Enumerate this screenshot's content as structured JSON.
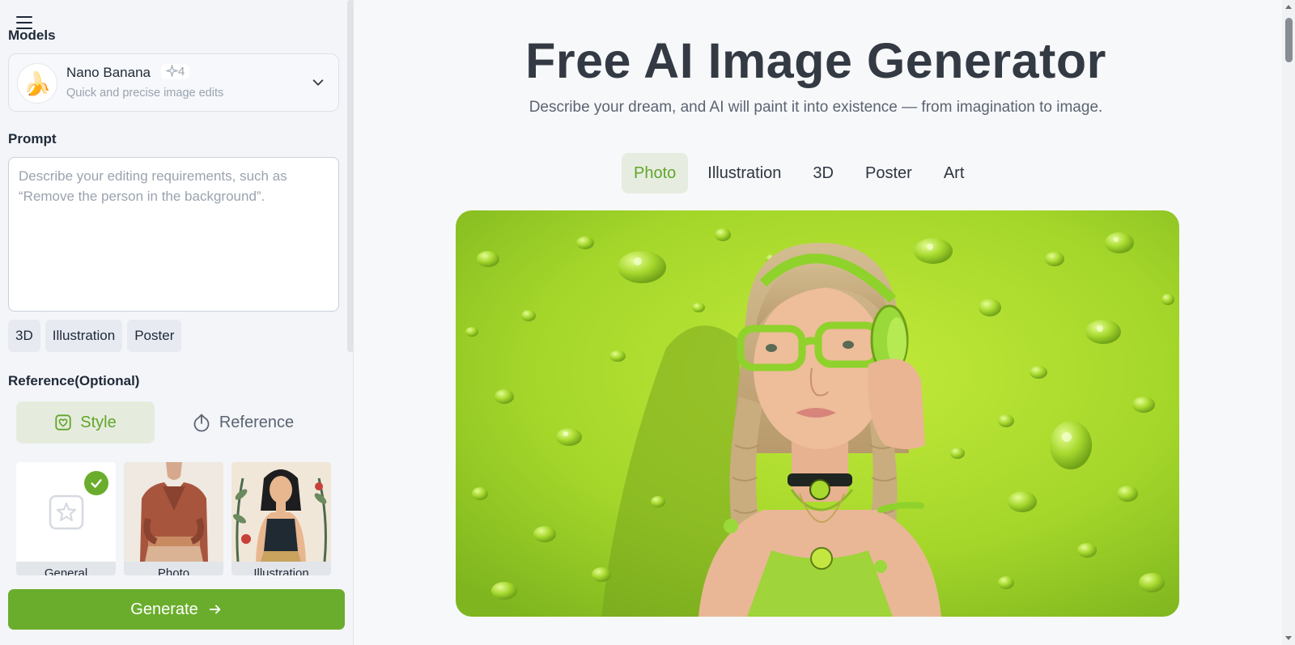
{
  "sidebar": {
    "models_title": "Models",
    "model": {
      "emoji": "🍌",
      "name": "Nano Banana",
      "credits": "4",
      "description": "Quick and precise image edits"
    },
    "prompt_title": "Prompt",
    "prompt": {
      "value": "",
      "placeholder": "Describe your editing requirements, such as “Remove the person in the background”."
    },
    "prompt_tags": [
      "3D",
      "Illustration",
      "Poster"
    ],
    "reference_title": "Reference(Optional)",
    "reference_tabs": {
      "style": "Style",
      "reference": "Reference"
    },
    "styles": [
      {
        "label": "General",
        "selected": true
      },
      {
        "label": "Photo",
        "selected": false
      },
      {
        "label": "Illustration",
        "selected": false
      }
    ],
    "generate_label": "Generate"
  },
  "main": {
    "title": "Free AI Image Generator",
    "subtitle": "Describe your dream, and AI will paint it into existence — from imagination to image.",
    "categories": [
      "Photo",
      "Illustration",
      "3D",
      "Poster",
      "Art"
    ],
    "active_category": "Photo"
  },
  "colors": {
    "accent": "#6aad2c",
    "accent_soft": "#e6ede0",
    "hero_background": "#a4d62a"
  }
}
